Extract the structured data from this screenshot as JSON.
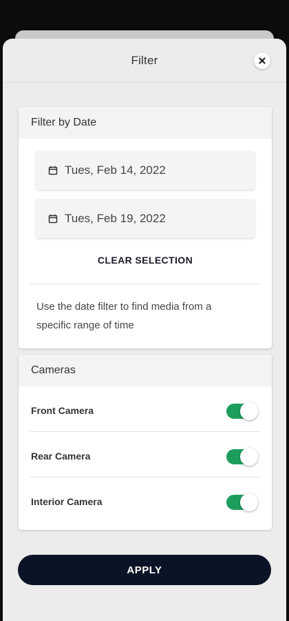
{
  "header": {
    "title": "Filter",
    "close_icon": "close-icon"
  },
  "date_filter": {
    "heading": "Filter by Date",
    "start_date": "Tues, Feb 14, 2022",
    "end_date": "Tues, Feb 19, 2022",
    "date_icon": "calendar-icon",
    "clear_label": "CLEAR SELECTION",
    "hint": "Use the date filter to find media from a specific range of time"
  },
  "cameras": {
    "heading": "Cameras",
    "toggle_on_color": "#1e9e5e",
    "items": [
      {
        "label": "Front Camera",
        "enabled": true
      },
      {
        "label": "Rear Camera",
        "enabled": true
      },
      {
        "label": "Interior Camera",
        "enabled": true
      }
    ]
  },
  "apply_label": "APPLY",
  "colors": {
    "primary_button": "#0b1326",
    "sheet_background": "#ececec"
  }
}
